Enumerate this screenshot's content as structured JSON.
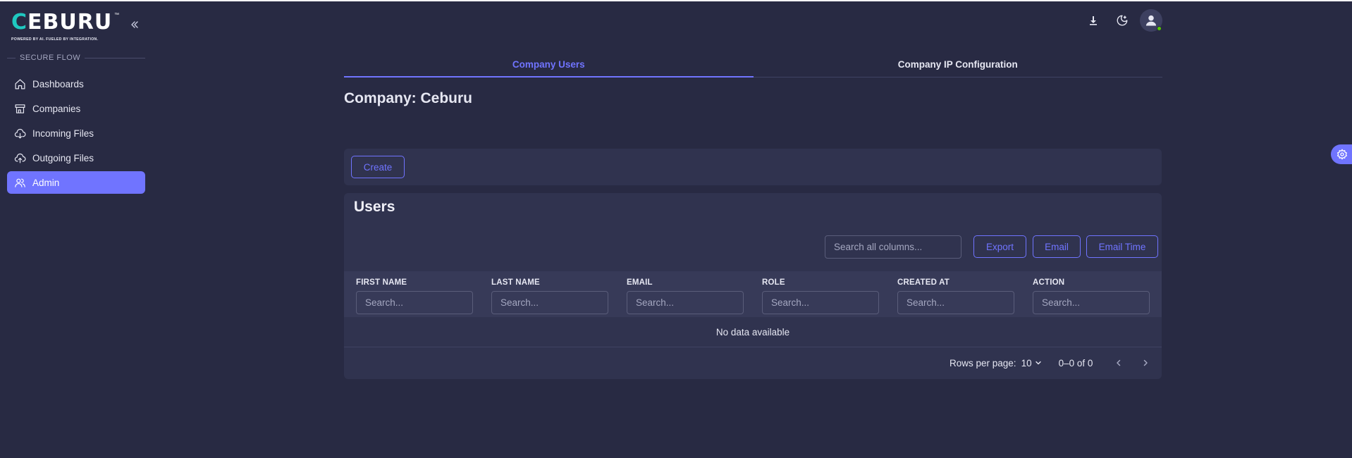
{
  "brand": {
    "logo_text_first": "C",
    "logo_text_rest": "EBURU",
    "trademark": "™",
    "tagline": "POWERED BY AI. FUELED BY INTEGRATION."
  },
  "sidebar": {
    "section_label": "SECURE FLOW",
    "items": [
      {
        "label": "Dashboards",
        "icon": "home-icon"
      },
      {
        "label": "Companies",
        "icon": "store-icon"
      },
      {
        "label": "Incoming Files",
        "icon": "cloud-download-icon"
      },
      {
        "label": "Outgoing Files",
        "icon": "cloud-upload-icon"
      },
      {
        "label": "Admin",
        "icon": "users-icon",
        "active": true
      }
    ]
  },
  "tabs": [
    {
      "label": "Company Users",
      "active": true
    },
    {
      "label": "Company IP Configuration",
      "active": false
    }
  ],
  "company_title": "Company: Ceburu",
  "toolbar": {
    "create_label": "Create"
  },
  "users": {
    "title": "Users",
    "search_placeholder": "Search all columns...",
    "export_label": "Export",
    "email_label": "Email",
    "email_time_label": "Email Time",
    "columns": [
      {
        "label": "FIRST NAME",
        "placeholder": "Search..."
      },
      {
        "label": "LAST NAME",
        "placeholder": "Search..."
      },
      {
        "label": "EMAIL",
        "placeholder": "Search..."
      },
      {
        "label": "ROLE",
        "placeholder": "Search..."
      },
      {
        "label": "CREATED AT",
        "placeholder": "Search..."
      },
      {
        "label": "ACTION",
        "placeholder": "Search..."
      }
    ],
    "empty_message": "No data available",
    "pagination": {
      "rows_per_page_label": "Rows per page:",
      "rows_per_page_value": "10",
      "range": "0–0 of 0"
    }
  },
  "colors": {
    "background": "#282a43",
    "surface": "#30334f",
    "accent": "#7074ff",
    "logo_accent": "#1fc8c0",
    "online": "#56ca00"
  }
}
